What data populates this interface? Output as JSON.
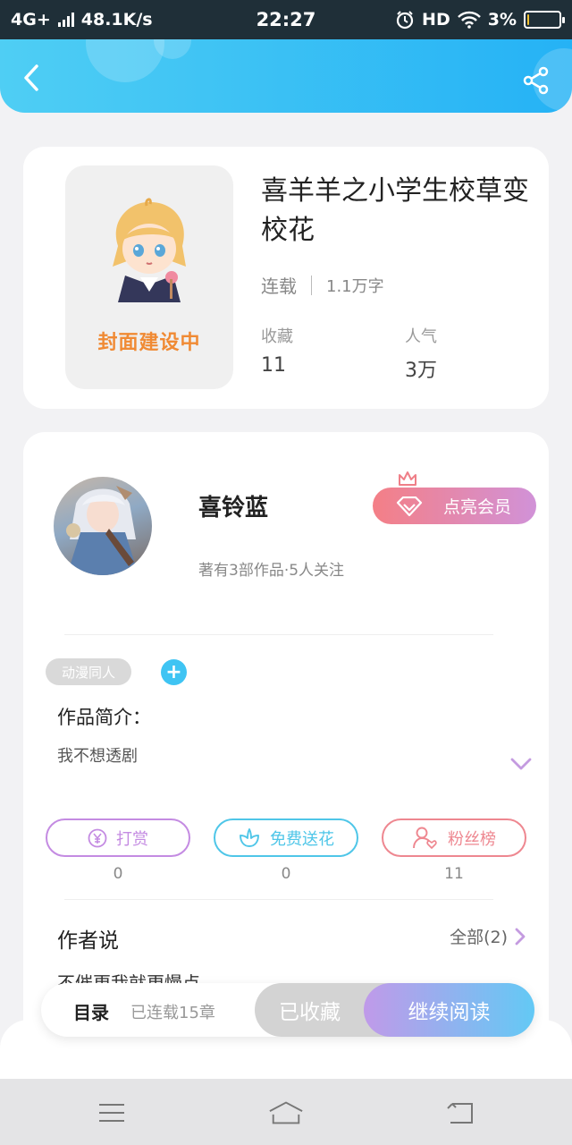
{
  "status_bar": {
    "network": "4G+",
    "speed": "48.1K/s",
    "time": "22:27",
    "hd": "HD",
    "battery": "3%",
    "battery_level": 0.03
  },
  "book": {
    "title": "喜羊羊之小学生校草变校花",
    "cover_placeholder": "封面建设中",
    "status": "连载",
    "word_count": "1.1万字",
    "favorites_label": "收藏",
    "favorites_value": "11",
    "popularity_label": "人气",
    "popularity_value": "3万"
  },
  "author": {
    "name": "喜铃蓝",
    "summary": "著有3部作品·5人关注",
    "vip_button": "点亮会员"
  },
  "work": {
    "tag": "动漫同人",
    "intro_heading": "作品简介：",
    "intro_text": "我不想透剧"
  },
  "actions": [
    {
      "label": "打赏",
      "count": "0",
      "color": "#c48be2"
    },
    {
      "label": "免费送花",
      "count": "0",
      "color": "#4fc6e8"
    },
    {
      "label": "粉丝榜",
      "count": "11",
      "color": "#ee8790"
    }
  ],
  "author_says": {
    "heading": "作者说",
    "all_label": "全部(2)",
    "preview": "不催更我就更慢点"
  },
  "read_bar": {
    "toc": "目录",
    "chapters": "已连载15章",
    "favorited": "已收藏",
    "continue": "继续阅读"
  },
  "colors": {
    "header_start": "#4fcef4",
    "header_end": "#25b2f5",
    "accent_purple": "#c09ae9",
    "accent_blue": "#63c9f5"
  }
}
